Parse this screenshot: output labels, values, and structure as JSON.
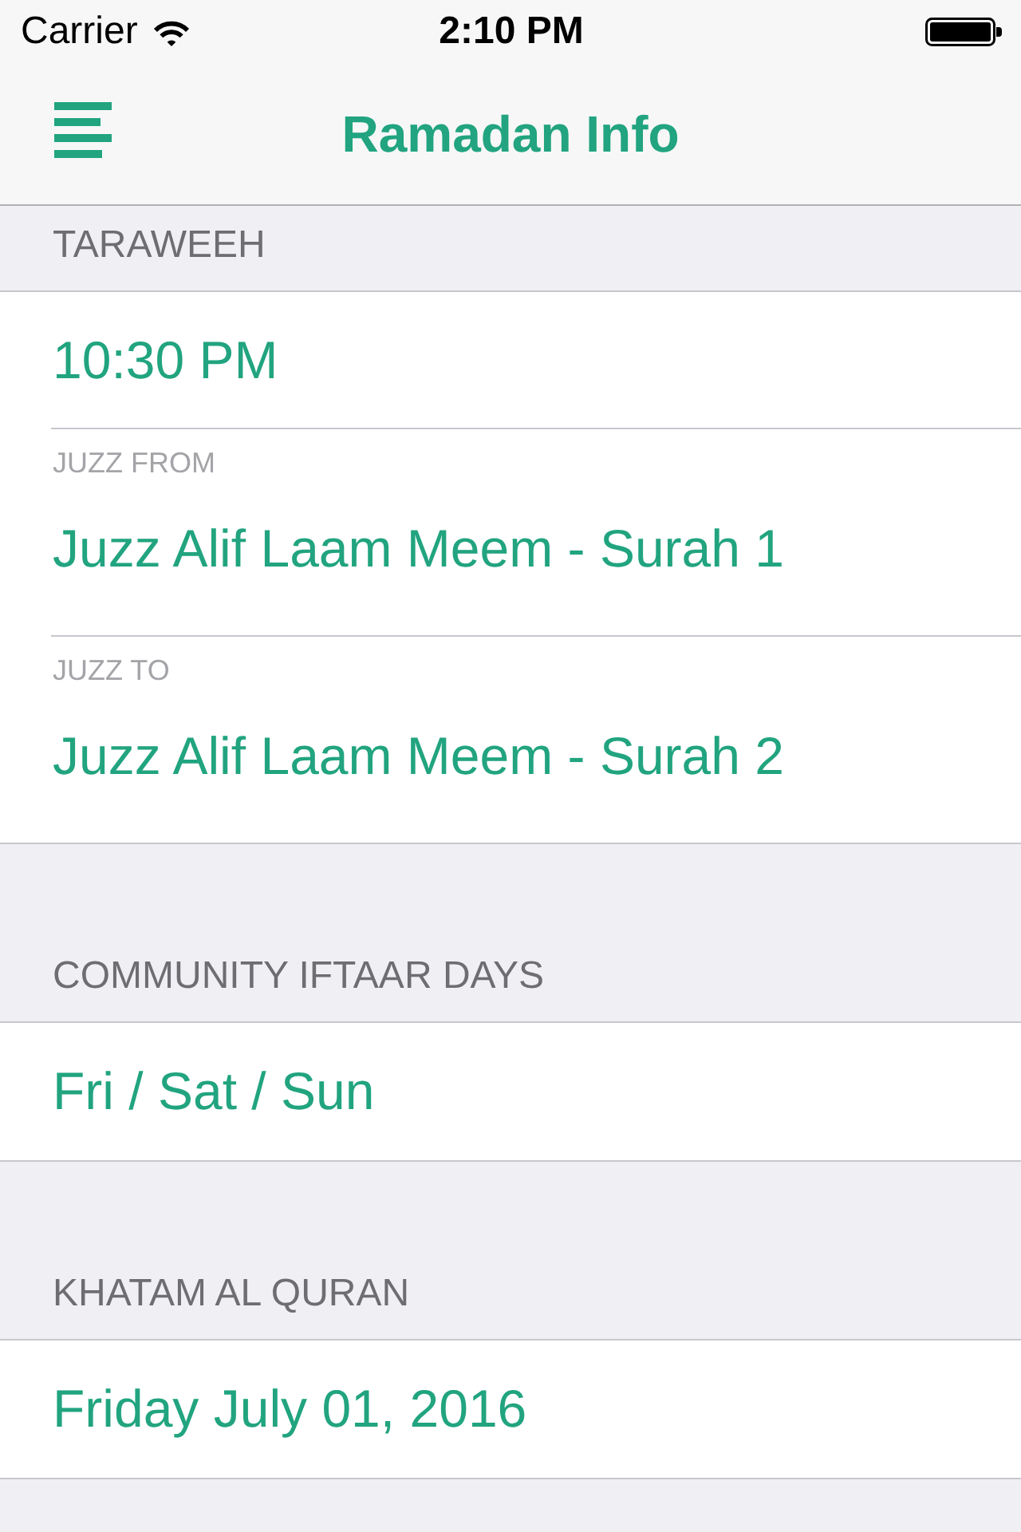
{
  "status_bar": {
    "carrier": "Carrier",
    "time": "2:10 PM"
  },
  "nav_bar": {
    "title": "Ramadan Info"
  },
  "sections": [
    {
      "header": "TARAWEEH",
      "rows": [
        {
          "kind": "value",
          "value": "10:30 PM"
        },
        {
          "kind": "labeled",
          "label": "JUZZ FROM",
          "value": "Juzz Alif Laam Meem - Surah 1"
        },
        {
          "kind": "labeled",
          "label": "JUZZ TO",
          "value": "Juzz Alif Laam Meem - Surah 2"
        }
      ]
    },
    {
      "header": "COMMUNITY IFTAAR DAYS",
      "rows": [
        {
          "kind": "value",
          "value": "Fri / Sat / Sun"
        }
      ]
    },
    {
      "header": "KHATAM AL QURAN",
      "rows": [
        {
          "kind": "value",
          "value": "Friday July 01, 2016"
        }
      ]
    }
  ]
}
